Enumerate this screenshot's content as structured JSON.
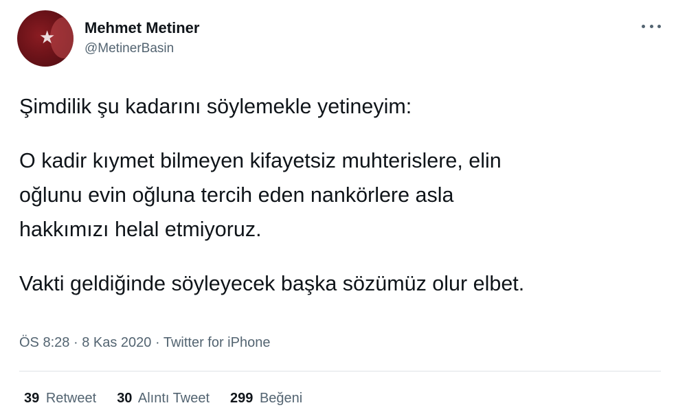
{
  "author": {
    "display_name": "Mehmet Metiner",
    "handle": "@MetinerBasin",
    "avatar_icon": "profile-photo"
  },
  "menu": {
    "icon": "more-horizontal-icon"
  },
  "tweet": {
    "paragraphs": [
      "Şimdilik şu kadarını söylemekle yetineyim:",
      "O kadir kıymet bilmeyen kifayetsiz muhterislere, elin\noğlunu evin oğluna tercih eden nankörlere asla\nhakkımızı helal etmiyoruz.",
      "Vakti geldiğinde söyleyecek başka sözümüz olur elbet."
    ]
  },
  "meta": {
    "time": "ÖS 8:28",
    "date": "8 Kas 2020",
    "source": "Twitter for iPhone",
    "separator": "·"
  },
  "stats": {
    "retweets": {
      "count": "39",
      "label": "Retweet"
    },
    "quotes": {
      "count": "30",
      "label": "Alıntı Tweet"
    },
    "likes": {
      "count": "299",
      "label": "Beğeni"
    }
  },
  "colors": {
    "text": "#0f1419",
    "secondary": "#536471",
    "divider": "#dfe3e6"
  }
}
